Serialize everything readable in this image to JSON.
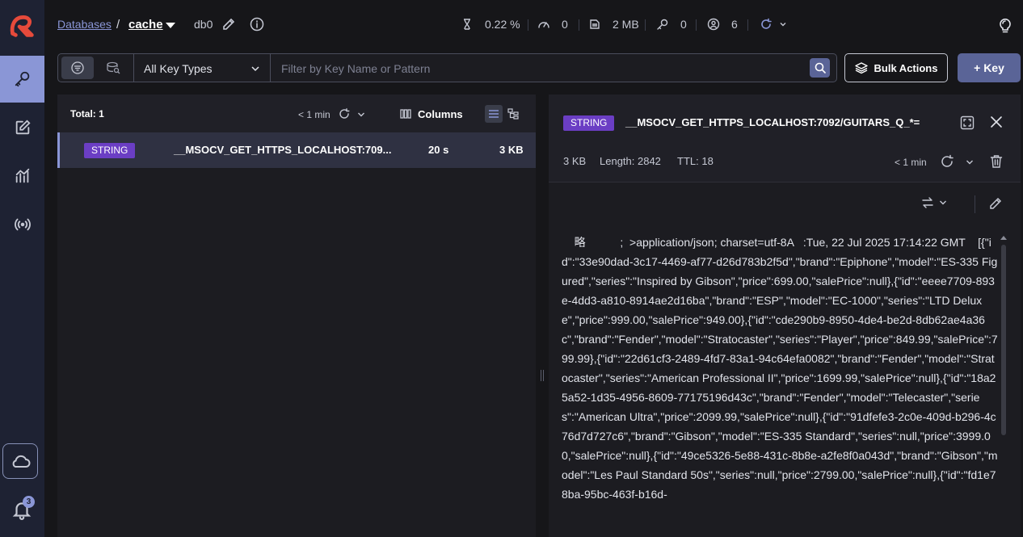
{
  "breadcrumb": {
    "databases": "Databases",
    "separator": "/",
    "current_db": "cache",
    "db_index": "db0"
  },
  "stats": {
    "cpu": "0.22 %",
    "ops": "0",
    "memory": "2 MB",
    "keys": "0",
    "clients": "6"
  },
  "filter": {
    "key_type": "All Key Types",
    "placeholder": "Filter by Key Name or Pattern"
  },
  "buttons": {
    "bulk": "Bulk Actions",
    "add_key": "+ Key"
  },
  "list": {
    "total": "Total: 1",
    "last_refresh": "< 1 min",
    "columns": "Columns",
    "rows": [
      {
        "type": "STRING",
        "name": "__MSOCV_GET_HTTPS_LOCALHOST:709...",
        "ttl": "20 s",
        "size": "3 KB"
      }
    ]
  },
  "detail": {
    "type": "STRING",
    "key": "__MSOCV_GET_HTTPS_LOCALHOST:7092/GUITARS_Q_*=",
    "size": "3 KB",
    "length": "Length: 2842",
    "ttl": "TTL:  18",
    "last_refresh": "< 1 min",
    "value": "    略           ;  >application/json; charset=utf-8A   :Tue, 22 Jul 2025 17:14:22 GMT    [{\"id\":\"33e90dad-3c17-4469-af77-d26d783b2f5d\",\"brand\":\"Epiphone\",\"model\":\"ES-335 Figured\",\"series\":\"Inspired by Gibson\",\"price\":699.00,\"salePrice\":null},{\"id\":\"eeee7709-893e-4dd3-a810-8914ae2d16ba\",\"brand\":\"ESP\",\"model\":\"EC-1000\",\"series\":\"LTD Deluxe\",\"price\":999.00,\"salePrice\":949.00},{\"id\":\"cde290b9-8950-4de4-be2d-8db62ae4a36c\",\"brand\":\"Fender\",\"model\":\"Stratocaster\",\"series\":\"Player\",\"price\":849.99,\"salePrice\":799.99},{\"id\":\"22d61cf3-2489-4fd7-83a1-94c64efa0082\",\"brand\":\"Fender\",\"model\":\"Stratocaster\",\"series\":\"American Professional II\",\"price\":1699.99,\"salePrice\":null},{\"id\":\"18a25a52-1d35-4956-8609-77175196d43c\",\"brand\":\"Fender\",\"model\":\"Telecaster\",\"series\":\"American Ultra\",\"price\":2099.99,\"salePrice\":null},{\"id\":\"91dfefe3-2c0e-409d-b296-4c76d7d727c6\",\"brand\":\"Gibson\",\"model\":\"ES-335 Standard\",\"series\":null,\"price\":3999.00,\"salePrice\":null},{\"id\":\"49ce5326-5e88-431c-8b8e-a2fe8f0a043d\",\"brand\":\"Gibson\",\"model\":\"Les Paul Standard 50s\",\"series\":null,\"price\":2799.00,\"salePrice\":null},{\"id\":\"fd1e78ba-95bc-463f-b16d-"
  },
  "notifications": {
    "count": "3"
  },
  "colors": {
    "accent": "#8a96d6",
    "badge_string": "#6b3ec4",
    "primary_button": "#5a6497",
    "sidebar_bg": "#1e2233"
  }
}
